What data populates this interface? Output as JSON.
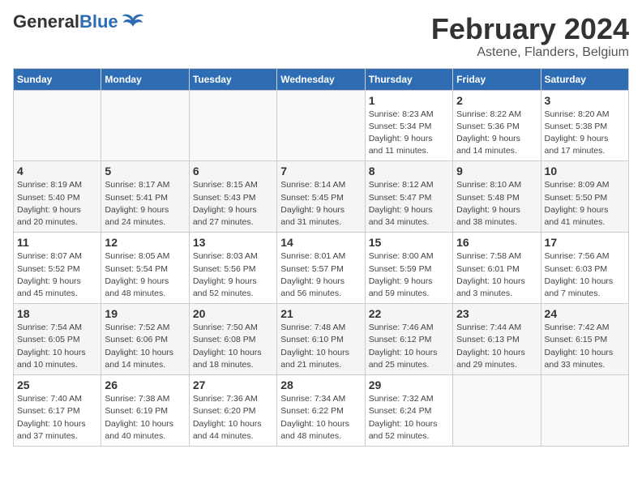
{
  "header": {
    "logo_general": "General",
    "logo_blue": "Blue",
    "title": "February 2024",
    "subtitle": "Astene, Flanders, Belgium"
  },
  "columns": [
    "Sunday",
    "Monday",
    "Tuesday",
    "Wednesday",
    "Thursday",
    "Friday",
    "Saturday"
  ],
  "weeks": [
    [
      {
        "day": "",
        "info": ""
      },
      {
        "day": "",
        "info": ""
      },
      {
        "day": "",
        "info": ""
      },
      {
        "day": "",
        "info": ""
      },
      {
        "day": "1",
        "info": "Sunrise: 8:23 AM\nSunset: 5:34 PM\nDaylight: 9 hours\nand 11 minutes."
      },
      {
        "day": "2",
        "info": "Sunrise: 8:22 AM\nSunset: 5:36 PM\nDaylight: 9 hours\nand 14 minutes."
      },
      {
        "day": "3",
        "info": "Sunrise: 8:20 AM\nSunset: 5:38 PM\nDaylight: 9 hours\nand 17 minutes."
      }
    ],
    [
      {
        "day": "4",
        "info": "Sunrise: 8:19 AM\nSunset: 5:40 PM\nDaylight: 9 hours\nand 20 minutes."
      },
      {
        "day": "5",
        "info": "Sunrise: 8:17 AM\nSunset: 5:41 PM\nDaylight: 9 hours\nand 24 minutes."
      },
      {
        "day": "6",
        "info": "Sunrise: 8:15 AM\nSunset: 5:43 PM\nDaylight: 9 hours\nand 27 minutes."
      },
      {
        "day": "7",
        "info": "Sunrise: 8:14 AM\nSunset: 5:45 PM\nDaylight: 9 hours\nand 31 minutes."
      },
      {
        "day": "8",
        "info": "Sunrise: 8:12 AM\nSunset: 5:47 PM\nDaylight: 9 hours\nand 34 minutes."
      },
      {
        "day": "9",
        "info": "Sunrise: 8:10 AM\nSunset: 5:48 PM\nDaylight: 9 hours\nand 38 minutes."
      },
      {
        "day": "10",
        "info": "Sunrise: 8:09 AM\nSunset: 5:50 PM\nDaylight: 9 hours\nand 41 minutes."
      }
    ],
    [
      {
        "day": "11",
        "info": "Sunrise: 8:07 AM\nSunset: 5:52 PM\nDaylight: 9 hours\nand 45 minutes."
      },
      {
        "day": "12",
        "info": "Sunrise: 8:05 AM\nSunset: 5:54 PM\nDaylight: 9 hours\nand 48 minutes."
      },
      {
        "day": "13",
        "info": "Sunrise: 8:03 AM\nSunset: 5:56 PM\nDaylight: 9 hours\nand 52 minutes."
      },
      {
        "day": "14",
        "info": "Sunrise: 8:01 AM\nSunset: 5:57 PM\nDaylight: 9 hours\nand 56 minutes."
      },
      {
        "day": "15",
        "info": "Sunrise: 8:00 AM\nSunset: 5:59 PM\nDaylight: 9 hours\nand 59 minutes."
      },
      {
        "day": "16",
        "info": "Sunrise: 7:58 AM\nSunset: 6:01 PM\nDaylight: 10 hours\nand 3 minutes."
      },
      {
        "day": "17",
        "info": "Sunrise: 7:56 AM\nSunset: 6:03 PM\nDaylight: 10 hours\nand 7 minutes."
      }
    ],
    [
      {
        "day": "18",
        "info": "Sunrise: 7:54 AM\nSunset: 6:05 PM\nDaylight: 10 hours\nand 10 minutes."
      },
      {
        "day": "19",
        "info": "Sunrise: 7:52 AM\nSunset: 6:06 PM\nDaylight: 10 hours\nand 14 minutes."
      },
      {
        "day": "20",
        "info": "Sunrise: 7:50 AM\nSunset: 6:08 PM\nDaylight: 10 hours\nand 18 minutes."
      },
      {
        "day": "21",
        "info": "Sunrise: 7:48 AM\nSunset: 6:10 PM\nDaylight: 10 hours\nand 21 minutes."
      },
      {
        "day": "22",
        "info": "Sunrise: 7:46 AM\nSunset: 6:12 PM\nDaylight: 10 hours\nand 25 minutes."
      },
      {
        "day": "23",
        "info": "Sunrise: 7:44 AM\nSunset: 6:13 PM\nDaylight: 10 hours\nand 29 minutes."
      },
      {
        "day": "24",
        "info": "Sunrise: 7:42 AM\nSunset: 6:15 PM\nDaylight: 10 hours\nand 33 minutes."
      }
    ],
    [
      {
        "day": "25",
        "info": "Sunrise: 7:40 AM\nSunset: 6:17 PM\nDaylight: 10 hours\nand 37 minutes."
      },
      {
        "day": "26",
        "info": "Sunrise: 7:38 AM\nSunset: 6:19 PM\nDaylight: 10 hours\nand 40 minutes."
      },
      {
        "day": "27",
        "info": "Sunrise: 7:36 AM\nSunset: 6:20 PM\nDaylight: 10 hours\nand 44 minutes."
      },
      {
        "day": "28",
        "info": "Sunrise: 7:34 AM\nSunset: 6:22 PM\nDaylight: 10 hours\nand 48 minutes."
      },
      {
        "day": "29",
        "info": "Sunrise: 7:32 AM\nSunset: 6:24 PM\nDaylight: 10 hours\nand 52 minutes."
      },
      {
        "day": "",
        "info": ""
      },
      {
        "day": "",
        "info": ""
      }
    ]
  ]
}
